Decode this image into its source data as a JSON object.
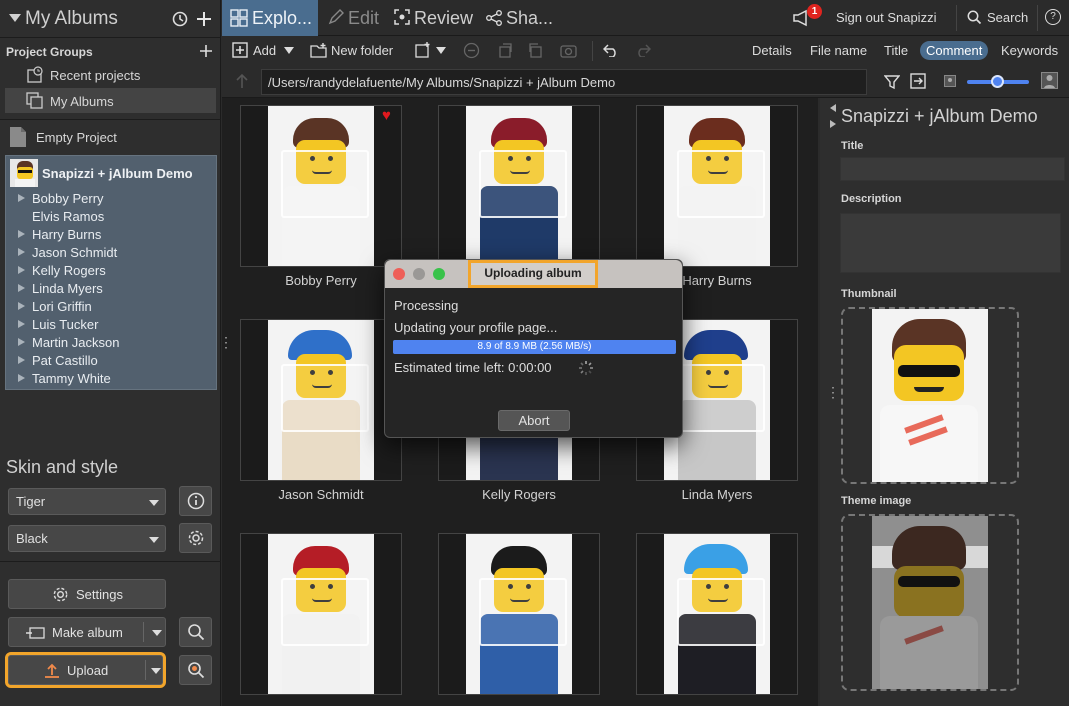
{
  "left": {
    "title": "My Albums",
    "project_groups_label": "Project Groups",
    "groups": [
      "Recent projects",
      "My Albums"
    ],
    "empty_project": "Empty Project",
    "album_title": "Snapizzi + jAlbum Demo",
    "tree_items": [
      {
        "label": "Bobby Perry",
        "expand": true
      },
      {
        "label": "Elvis Ramos",
        "expand": false
      },
      {
        "label": "Harry Burns",
        "expand": true
      },
      {
        "label": "Jason Schmidt",
        "expand": true
      },
      {
        "label": "Kelly Rogers",
        "expand": true
      },
      {
        "label": "Linda Myers",
        "expand": true
      },
      {
        "label": "Lori Griffin",
        "expand": true
      },
      {
        "label": "Luis Tucker",
        "expand": true
      },
      {
        "label": "Martin Jackson",
        "expand": true
      },
      {
        "label": "Pat Castillo",
        "expand": true
      },
      {
        "label": "Tammy White",
        "expand": true
      }
    ],
    "skin_title": "Skin and style",
    "skin_value": "Tiger",
    "style_value": "Black",
    "settings_label": "Settings",
    "make_album_label": "Make album",
    "upload_label": "Upload"
  },
  "tabs": [
    "Explo...",
    "Edit",
    "Review",
    "Sha..."
  ],
  "top_right": {
    "notif_count": "1",
    "signout": "Sign out Snapizzi",
    "search": "Search",
    "help": "?"
  },
  "toolbar": {
    "add": "Add",
    "new_folder": "New folder",
    "fields": [
      "Details",
      "File name",
      "Title",
      "Comment",
      "Keywords"
    ],
    "active_field": "Comment"
  },
  "path": "/Users/randydelafuente/My Albums/Snapizzi + jAlbum Demo",
  "grid": [
    {
      "name": "Bobby Perry",
      "shirt": "#f4f4f4",
      "hair": "#5a3425",
      "hat": "",
      "fav": true
    },
    {
      "name": "",
      "shirt": "#1f3a68",
      "hair": "#8a1c2a",
      "hat": "",
      "fav": false
    },
    {
      "name": "Harry Burns",
      "shirt": "#f2f2f2",
      "hair": "#6b2d1e",
      "hat": "",
      "fav": false
    },
    {
      "name": "Jason Schmidt",
      "shirt": "#e9dcc6",
      "hair": "",
      "hat": "#2f70c9",
      "fav": false
    },
    {
      "name": "Kelly Rogers",
      "shirt": "#2a3450",
      "hair": "",
      "hat": "",
      "fav": false
    },
    {
      "name": "Linda Myers",
      "shirt": "#c7c7c7",
      "hair": "",
      "hat": "#1f3f8c",
      "fav": false
    },
    {
      "name": "",
      "shirt": "#f1f1f1",
      "hair": "#b51d26",
      "hat": "",
      "fav": false
    },
    {
      "name": "",
      "shirt": "#2f5fa8",
      "hair": "#1b1b1b",
      "hat": "",
      "fav": false
    },
    {
      "name": "",
      "shirt": "#1e1e24",
      "hair": "",
      "hat": "#3aa0e6",
      "fav": false
    }
  ],
  "right": {
    "album_title": "Snapizzi + jAlbum Demo",
    "title_label": "Title",
    "description_label": "Description",
    "thumbnail_label": "Thumbnail",
    "theme_label": "Theme image"
  },
  "dialog": {
    "title": "Uploading album",
    "status": "Processing",
    "step": "Updating your profile page...",
    "progress_text": "8.9 of 8.9 MB  (2.56 MB/s)",
    "progress": 1.0,
    "eta": "Estimated time left: 0:00:00",
    "abort": "Abort"
  },
  "colors": {
    "accent": "#4a6d8f",
    "highlight": "#f2a52b",
    "progress": "#4f83f0",
    "tree_bg": "#52606e"
  }
}
